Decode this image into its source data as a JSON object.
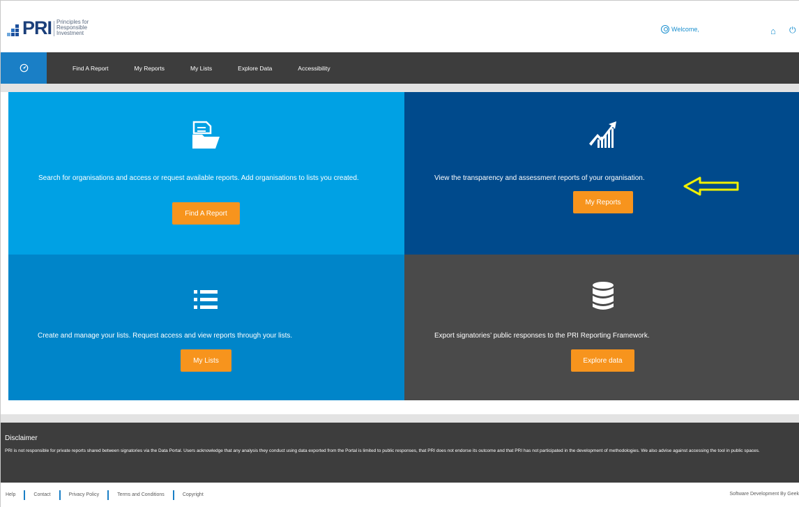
{
  "header": {
    "logo_text": "PRI",
    "logo_subtitle_line1": "Principles for",
    "logo_subtitle_line2": "Responsible",
    "logo_subtitle_line3": "Investment",
    "welcome_label": "Welcome,"
  },
  "nav": {
    "items": [
      {
        "label": "Find A Report"
      },
      {
        "label": "My Reports"
      },
      {
        "label": "My Lists"
      },
      {
        "label": "Explore Data"
      },
      {
        "label": "Accessibility"
      }
    ]
  },
  "tiles": {
    "find_report": {
      "description": "Search for organisations and access or request available reports. Add organisations to lists you created.",
      "button": "Find A Report",
      "icon": "document-folder-icon",
      "color": "#00a1e4"
    },
    "my_reports": {
      "description": "View the transparency and assessment reports of your organisation.",
      "button": "My Reports",
      "icon": "chart-growth-icon",
      "color": "#004a8c"
    },
    "my_lists": {
      "description": "Create and manage your lists. Request access and view reports through your lists.",
      "button": "My Lists",
      "icon": "list-icon",
      "color": "#0085c9"
    },
    "explore_data": {
      "description": "Export signatories’ public responses to the PRI Reporting Framework.",
      "button": "Explore data",
      "icon": "database-icon",
      "color": "#4a4a4a"
    }
  },
  "accent_colors": {
    "button": "#f7941d",
    "nav_bg": "#3d3d3d",
    "annotation_arrow": "#f0f000"
  },
  "disclaimer": {
    "title": "Disclaimer",
    "text": "PRI is not responsible for private reports shared between signatories via the Data Portal. Users acknowledge that any analysis they conduct using data exported from the Portal is limited to public responses, that PRI does not endorse its outcome and that PRI has not participated in the development of methodologies. We also advise against accessing the tool in public spaces."
  },
  "footer": {
    "links": [
      {
        "label": "Help"
      },
      {
        "label": "Contact"
      },
      {
        "label": "Privacy Policy"
      },
      {
        "label": "Terms and Conditions"
      },
      {
        "label": "Copyright"
      }
    ],
    "credit": "Software Development By Geek"
  }
}
